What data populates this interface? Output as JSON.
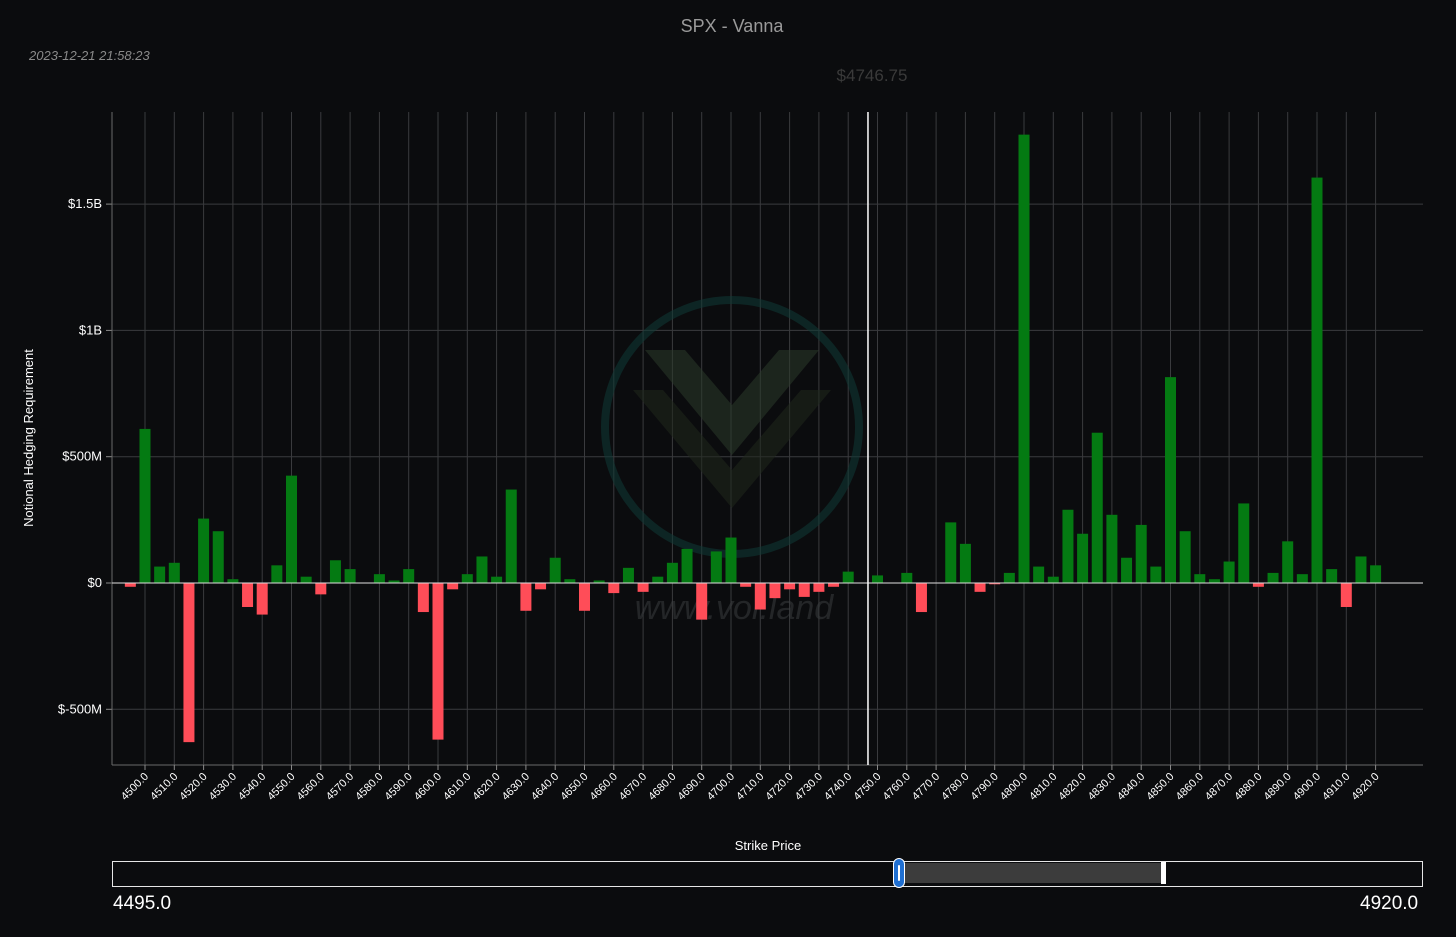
{
  "header": {
    "title": "SPX - Vanna",
    "timestamp": "2023-12-21 21:58:23",
    "spot_label": "$4746.75"
  },
  "watermark": {
    "text": "www.vol.land",
    "logo": "vol-land-logo-icon"
  },
  "colors": {
    "positive": "#047a12",
    "negative": "#ff4d58",
    "spot_line": "#ffffff",
    "grid": "#3a3b3e",
    "background": "#0b0c0e"
  },
  "chart_data": {
    "type": "bar",
    "title": "SPX - Vanna",
    "xlabel": "Strike Price",
    "ylabel": "Notional Hedging Requirement",
    "spot": 4746.75,
    "ylim": [
      -720,
      1880
    ],
    "yticks": [
      {
        "value": -500,
        "label": "$-500M"
      },
      {
        "value": 0,
        "label": "$0"
      },
      {
        "value": 500,
        "label": "$500M"
      },
      {
        "value": 1000,
        "label": "$1B"
      },
      {
        "value": 1500,
        "label": "$1.5B"
      }
    ],
    "x": [
      4495,
      4500,
      4505,
      4510,
      4515,
      4520,
      4525,
      4530,
      4535,
      4540,
      4545,
      4550,
      4555,
      4560,
      4565,
      4570,
      4580,
      4585,
      4590,
      4595,
      4600,
      4605,
      4610,
      4615,
      4620,
      4625,
      4630,
      4635,
      4640,
      4645,
      4650,
      4655,
      4660,
      4665,
      4670,
      4675,
      4680,
      4685,
      4690,
      4695,
      4700,
      4705,
      4710,
      4715,
      4720,
      4725,
      4730,
      4735,
      4740,
      4750,
      4760,
      4765,
      4775,
      4780,
      4785,
      4790,
      4795,
      4800,
      4805,
      4810,
      4815,
      4820,
      4825,
      4830,
      4835,
      4840,
      4845,
      4850,
      4855,
      4860,
      4865,
      4870,
      4875,
      4880,
      4885,
      4890,
      4895,
      4900,
      4905,
      4910,
      4915,
      4920
    ],
    "values": [
      -15,
      610,
      65,
      80,
      -630,
      255,
      205,
      15,
      -95,
      -125,
      70,
      425,
      25,
      -45,
      90,
      55,
      35,
      10,
      55,
      -115,
      -620,
      -25,
      35,
      105,
      25,
      370,
      -110,
      -25,
      100,
      15,
      -110,
      10,
      -40,
      60,
      -35,
      25,
      80,
      135,
      -145,
      125,
      180,
      -15,
      -105,
      -60,
      -25,
      -55,
      -35,
      -15,
      45,
      30,
      40,
      -115,
      240,
      155,
      -35,
      -5,
      40,
      1775,
      65,
      25,
      290,
      195,
      595,
      270,
      100,
      230,
      65,
      815,
      205,
      35,
      15,
      85,
      315,
      -15,
      40,
      165,
      35,
      1605,
      55,
      -95,
      105,
      70
    ],
    "x_ticks": [
      4500,
      4510,
      4520,
      4530,
      4540,
      4550,
      4560,
      4570,
      4580,
      4590,
      4600,
      4610,
      4620,
      4630,
      4640,
      4650,
      4660,
      4670,
      4680,
      4690,
      4700,
      4710,
      4720,
      4730,
      4740,
      4750,
      4760,
      4770,
      4780,
      4790,
      4800,
      4810,
      4820,
      4830,
      4840,
      4850,
      4860,
      4870,
      4880,
      4890,
      4900,
      4910,
      4920
    ],
    "grid": true
  },
  "range_slider": {
    "min_label": "4495.0",
    "max_label": "4920.0",
    "min": 4495,
    "max": 4920,
    "selected_start": 4750,
    "selected_end": 4835
  }
}
